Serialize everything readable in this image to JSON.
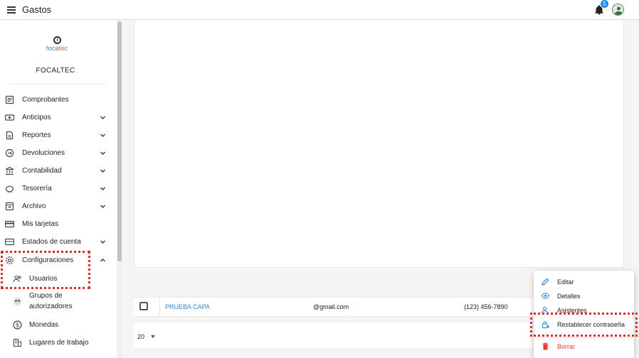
{
  "app": {
    "title": "Gastos",
    "notification_count": "5"
  },
  "org": {
    "logo_text_a": "foca",
    "logo_text_b": "tec",
    "name": "FOCALTEC"
  },
  "sidebar": {
    "items": [
      {
        "label": "Comprobantes",
        "icon": "receipt-icon",
        "expandable": false
      },
      {
        "label": "Anticipos",
        "icon": "cash-icon",
        "expandable": true
      },
      {
        "label": "Reportes",
        "icon": "report-icon",
        "expandable": true
      },
      {
        "label": "Devoluciones",
        "icon": "refund-icon",
        "expandable": true
      },
      {
        "label": "Contabilidad",
        "icon": "bank-icon",
        "expandable": true
      },
      {
        "label": "Tesorería",
        "icon": "piggy-bank-icon",
        "expandable": true
      },
      {
        "label": "Archivo",
        "icon": "archive-icon",
        "expandable": true
      },
      {
        "label": "Mis tarjetas",
        "icon": "credit-card-icon",
        "expandable": false
      },
      {
        "label": "Estados de cuenta",
        "icon": "wallet-icon",
        "expandable": true
      },
      {
        "label": "Configuraciones",
        "icon": "gear-icon",
        "expandable": true,
        "expanded": true
      }
    ],
    "sub_items": [
      {
        "label": "Usuarios",
        "icon": "users-icon"
      },
      {
        "label": "Grupos de autorizadores",
        "icon": "group-icon"
      },
      {
        "label": "Monedas",
        "icon": "dollar-icon"
      },
      {
        "label": "Lugares de trabajo",
        "icon": "building-icon"
      }
    ]
  },
  "table": {
    "row": {
      "name": "PRUEBA CAPA",
      "email": "@gmail.com",
      "phone": "(123) 456-7890"
    },
    "page_size": "20"
  },
  "context_menu": {
    "items": [
      {
        "label": "Editar",
        "icon": "pencil-icon"
      },
      {
        "label": "Detalles",
        "icon": "eye-icon"
      },
      {
        "label": "Asistentes",
        "icon": "assistant-icon"
      },
      {
        "label": "Restablecer contraseña",
        "icon": "lock-reset-icon"
      },
      {
        "label": "Borrar",
        "icon": "trash-icon"
      }
    ]
  },
  "colors": {
    "accent": "#1e88e5",
    "link": "#3b87c9",
    "danger": "#e53935",
    "highlight": "#d9302a"
  }
}
